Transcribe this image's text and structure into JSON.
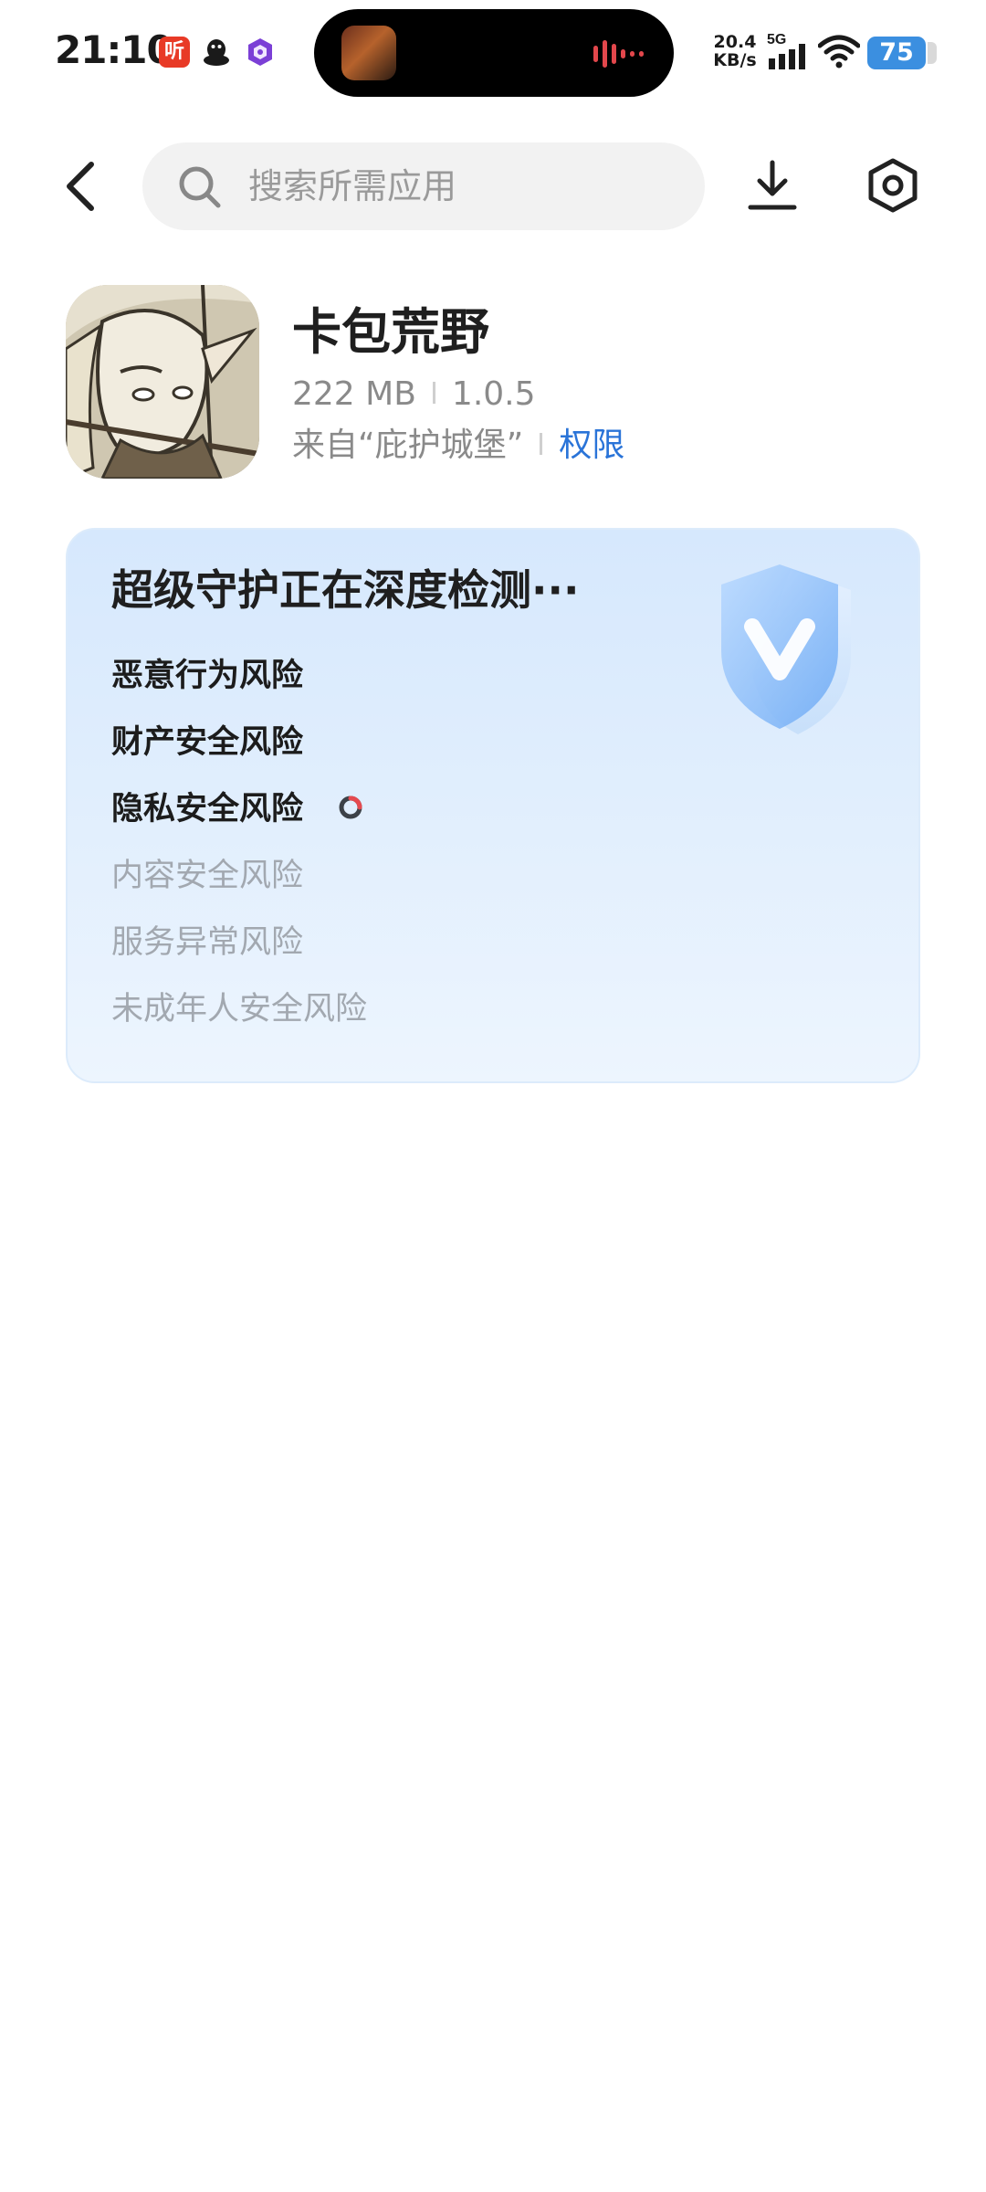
{
  "status_bar": {
    "time": "21:10",
    "listen_app_glyph": "听",
    "net_speed_value": "20.4",
    "net_speed_unit": "KB/s",
    "network_type": "5G",
    "battery_level": "75",
    "icons": [
      "listen-app-icon",
      "qq-icon",
      "purple-app-icon",
      "media-waveform-icon",
      "signal-icon",
      "wifi-icon",
      "battery-icon"
    ]
  },
  "top_bar": {
    "search_placeholder": "搜索所需应用",
    "icons": [
      "back-arrow-icon",
      "search-icon",
      "download-icon",
      "settings-hexagon-icon"
    ]
  },
  "app": {
    "name": "卡包荒野",
    "size": "222 MB",
    "version": "1.0.5",
    "source": "来自“庇护城堡”",
    "permissions_label": "权限"
  },
  "scan": {
    "title": "超级守护正在深度检测···",
    "badge_icon": "v-shield-icon",
    "items": [
      {
        "label": "恶意行为风险",
        "state": "done"
      },
      {
        "label": "财产安全风险",
        "state": "done"
      },
      {
        "label": "隐私安全风险",
        "state": "checking"
      },
      {
        "label": "内容安全风险",
        "state": "pending"
      },
      {
        "label": "服务异常风险",
        "state": "pending"
      },
      {
        "label": "未成年人安全风险",
        "state": "pending"
      }
    ]
  },
  "colors": {
    "accent_link": "#2a74d8",
    "battery": "#3b8fe0",
    "listen_app": "#e83a26",
    "card_top": "#d6e8fd",
    "card_bottom": "#edf5fe",
    "pending_text": "#a2a8b0"
  }
}
